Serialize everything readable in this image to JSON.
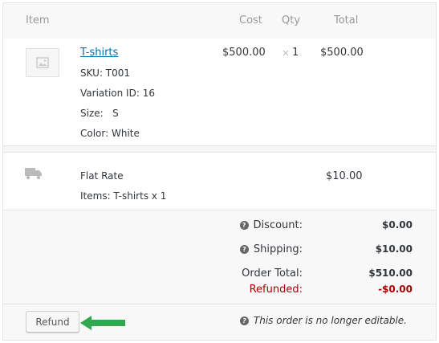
{
  "columns": {
    "item": "Item",
    "cost": "Cost",
    "qty": "Qty",
    "total": "Total"
  },
  "line_item": {
    "name": "T-shirts",
    "sku": "SKU: T001",
    "variation_id": "Variation ID: 16",
    "size": "Size:   S",
    "color": "Color: White",
    "cost": "$500.00",
    "qty_prefix": "×",
    "qty": "1",
    "total": "$500.00"
  },
  "shipping": {
    "method": "Flat Rate",
    "items": "Items: T-shirts x 1",
    "total": "$10.00"
  },
  "totals": {
    "discount_label": "Discount:",
    "discount_value": "$0.00",
    "shipping_label": "Shipping:",
    "shipping_value": "$10.00",
    "order_total_label": "Order Total:",
    "order_total_value": "$510.00",
    "refunded_label": "Refunded:",
    "refunded_value": "-$0.00"
  },
  "footer": {
    "refund_button": "Refund",
    "not_editable_notice": "This order is no longer editable."
  },
  "icons": {
    "help": "question-circle-icon",
    "thumbnail": "image-placeholder-icon",
    "shipping": "truck-icon",
    "pointer": "arrow-left-icon"
  },
  "colors": {
    "link": "#0073aa",
    "refunded": "#aa0000",
    "arrow": "#2fa84f"
  }
}
